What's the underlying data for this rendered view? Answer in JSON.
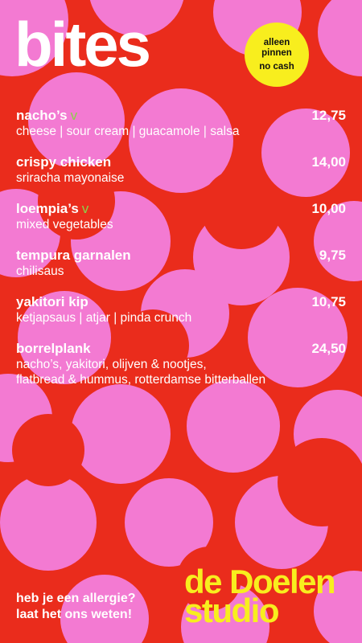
{
  "header": {
    "title": "bites",
    "badge": {
      "line1": "alleen",
      "line2": "pinnen",
      "line3": "no cash"
    }
  },
  "menu": [
    {
      "name": "nacho’s",
      "veg": "v",
      "price": "12,75",
      "desc": [
        "cheese | sour cream | guacamole | salsa"
      ]
    },
    {
      "name": "crispy chicken",
      "veg": "",
      "price": "14,00",
      "desc": [
        "sriracha mayonaise"
      ]
    },
    {
      "name": "loempia’s",
      "veg": "v",
      "price": "10,00",
      "desc": [
        "mixed vegetables"
      ]
    },
    {
      "name": "tempura garnalen",
      "veg": "",
      "price": "9,75",
      "desc": [
        "chilisaus"
      ]
    },
    {
      "name": "yakitori kip",
      "veg": "",
      "price": "10,75",
      "desc": [
        "ketjapsaus | atjar | pinda crunch"
      ]
    },
    {
      "name": "borrelplank",
      "veg": "",
      "price": "24,50",
      "desc": [
        "nacho’s, yakitori, olijven & nootjes,",
        "flatbread & hummus, rotterdamse bitterballen"
      ]
    }
  ],
  "footer": {
    "allergy_line1": "heb je een allergie?",
    "allergy_line2": "laat het ons weten!",
    "logo_line1": "de Doelen",
    "logo_line2": "studio"
  },
  "colors": {
    "background": "#ea2c1c",
    "pattern": "#f37ad2",
    "badge": "#f8ee1e",
    "logo": "#f8ee1e",
    "veg": "#8bd14a",
    "text": "#ffffff"
  }
}
